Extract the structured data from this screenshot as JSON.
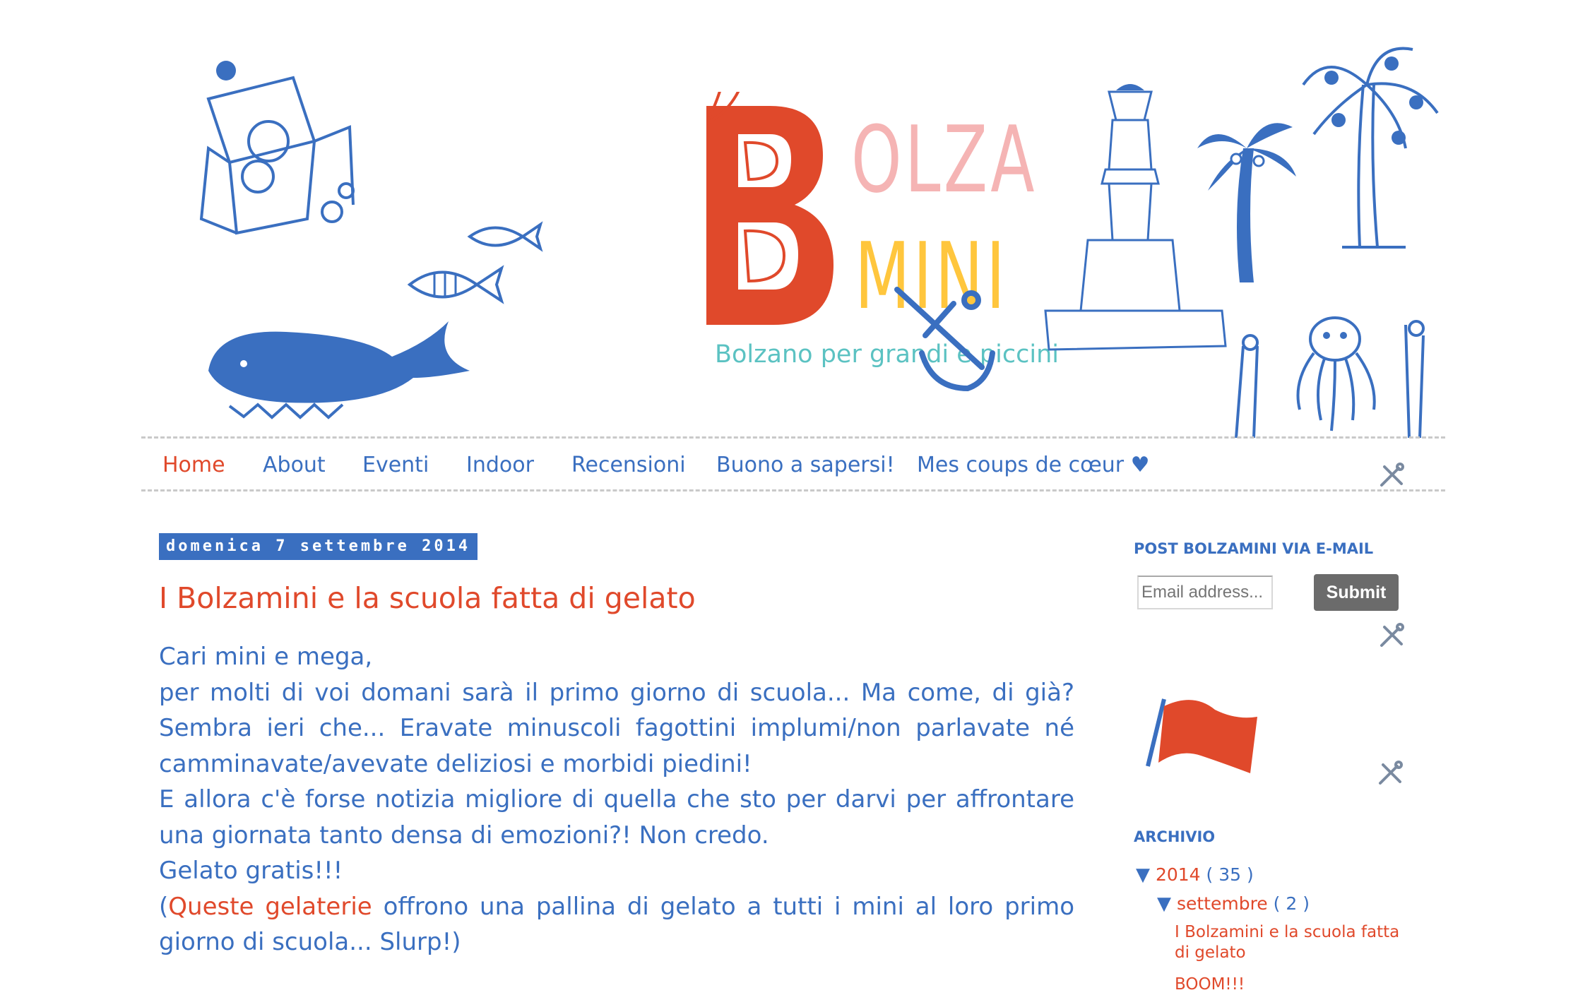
{
  "header": {
    "logo_letter": "B",
    "logo_top": "OLZA",
    "logo_bottom": "MINI",
    "tagline": "Bolzano per grandi e piccini",
    "colors": {
      "red": "#e0492b",
      "pink": "#f5b4b4",
      "yellow": "#ffc63d",
      "teal": "#5bc2c2",
      "blue": "#3a6fc0"
    }
  },
  "nav": {
    "items": [
      {
        "label": "Home",
        "active": true
      },
      {
        "label": "About"
      },
      {
        "label": "Eventi"
      },
      {
        "label": "Indoor"
      },
      {
        "label": "Recensioni"
      },
      {
        "label": "Buono a sapersi!"
      },
      {
        "label": "Mes coups de cœur ♥"
      }
    ]
  },
  "post": {
    "date": "domenica 7 settembre 2014",
    "title": "I Bolzamini e la scuola fatta di gelato",
    "lines": [
      "Cari mini e mega,",
      "per molti di voi domani sarà il primo giorno di scuola... Ma come, di già? Sembra ieri che... Eravate minuscoli fagottini implumi/non parlavate né camminavate/avevate deliziosi e morbidi piedini!",
      "E allora c'è forse notizia migliore di quella che sto per darvi per affrontare una giornata tanto densa di emozioni?! Non credo.",
      "Gelato gratis!!!"
    ],
    "last_open": "(",
    "link": "Queste gelaterie",
    "last_rest": " offrono una pallina di gelato a tutti i mini al loro primo giorno di scuola... Slurp!)"
  },
  "sidebar": {
    "email_heading": "POST BOLZAMINI VIA E-MAIL",
    "email_placeholder": "Email address...",
    "submit": "Submit",
    "archive_heading": "ARCHIVIO",
    "year": "2014",
    "year_count": "( 35 )",
    "month": "settembre",
    "month_count": "( 2 )",
    "posts": [
      "I Bolzamini e la scuola fatta di gelato",
      "BOOM!!!"
    ]
  }
}
